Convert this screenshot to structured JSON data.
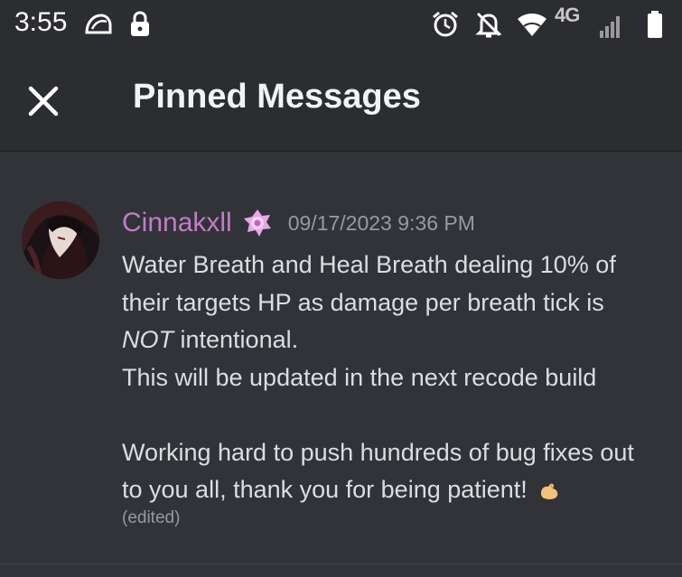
{
  "status_bar": {
    "time": "3:55",
    "network": "4G",
    "icons": [
      "taco-bell-icon",
      "lock-icon",
      "alarm-icon",
      "notifications-off-icon",
      "wifi-icon",
      "cell-signal-icon",
      "battery-icon"
    ]
  },
  "header": {
    "title": "Pinned Messages",
    "close_icon": "close-icon"
  },
  "message": {
    "author": "Cinnakxll",
    "author_color": "#c27cc6",
    "role_icon": "role-badge-icon",
    "timestamp": "09/17/2023 9:36 PM",
    "lines": [
      "Water Breath and Heal Breath dealing 10% of",
      "their targets HP as damage per breath tick is",
      {
        "italic": "NOT",
        "rest": " intentional."
      },
      "This will be updated in the next recode build",
      "",
      "Working hard to push hundreds of bug fixes out",
      "to you all, thank you for being patient!"
    ],
    "emoji": "muscle-emoji-icon",
    "edited_label": "(edited)"
  },
  "colors": {
    "background": "#313338",
    "header_bg": "#2b2d31",
    "text": "#dbdee1",
    "muted": "#949ba4"
  }
}
